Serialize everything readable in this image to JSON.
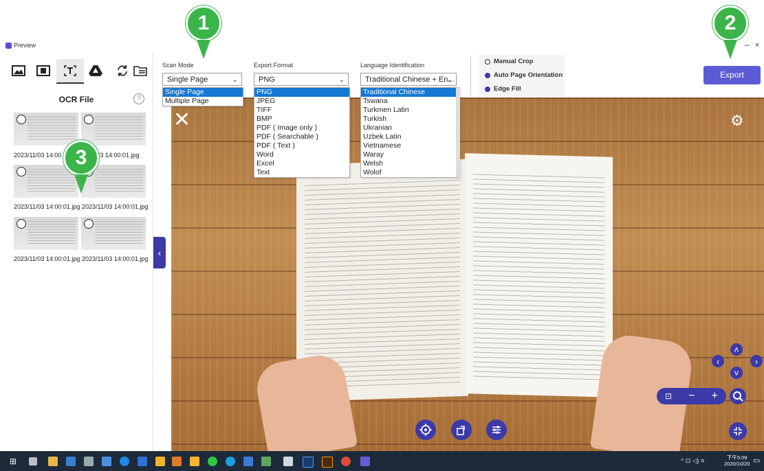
{
  "window": {
    "title": "Preview",
    "minimize": "–",
    "close": "×"
  },
  "left_panel": {
    "section_title": "OCR File",
    "help": "?",
    "thumbnails": [
      "2023/11/03 14:00:01.jpg",
      "2023/11/03 14:00:01.jpg",
      "2023/11/03 14:00:01.jpg",
      "2023/11/03 14:00:01.jpg",
      "2023/11/03 14:00:01.jpg",
      "2023/11/03 14:00:01.jpg"
    ],
    "thumb_caption_0_partial": "2023/11/03 14:00",
    "thumb_caption_1_partial": "/3 14:00:01.jpg",
    "collapse": "‹"
  },
  "toolbar": {
    "scan_mode": {
      "label": "Scan Mode",
      "value": "Single Page",
      "options": [
        "Single Page",
        "Multiple Page"
      ]
    },
    "export_format": {
      "label": "Export Format",
      "value": "PNG",
      "options": [
        "PNG",
        "JPEG",
        "TIFF",
        "BMP",
        "PDF ( Image only )",
        "PDF ( Searchable )",
        "PDF ( Text )",
        "Word",
        "Excel",
        "Text"
      ]
    },
    "language": {
      "label": "Language Identification",
      "value": "Traditional Chinese + En...",
      "options": [
        "Traditional Chinese",
        "Tswana",
        "Turkmen Latin",
        "Turkish",
        "Ukranian",
        "Uzbek Latin",
        "Vietnamese",
        "Waray",
        "Welsh",
        "Wolof"
      ]
    },
    "options": [
      {
        "label": "Manual Crop",
        "checked": false
      },
      {
        "label": "Auto Page Orientation",
        "checked": true
      },
      {
        "label": "Edge Fill",
        "checked": true
      }
    ],
    "export_label": "Export"
  },
  "markers": [
    "1",
    "2",
    "3"
  ],
  "taskbar": {
    "time": "下午5:09",
    "date": "2020/10/20"
  },
  "colors": {
    "accent": "#3b3aa8",
    "export": "#5b5bd6",
    "selected": "#1478d4",
    "marker": "#3bb54a"
  }
}
